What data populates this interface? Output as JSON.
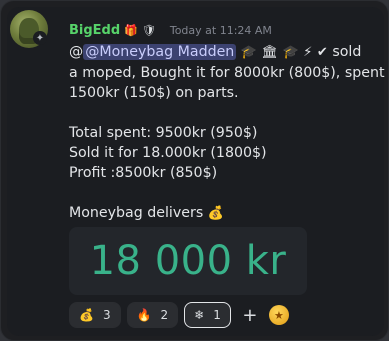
{
  "message": {
    "username": "BigEdd",
    "badge_icons": [
      "gift-icon",
      "shield-icon"
    ],
    "timestamp": "Today at 11:24 AM",
    "text_prefix": "@",
    "mention": "@Moneybag Madden",
    "lines_after_mention": " sold",
    "mention_icons": [
      "graduation-cap-icon",
      "bank-icon",
      "graduation-cap-icon",
      "lightning-icon",
      "verified-icon"
    ],
    "body_lines": [
      "a moped, Bought it for 8000kr (800$), spent",
      "1500kr (150$) on parts.",
      "",
      "Total spent: 9500kr (950$)",
      "Sold it for 18.000kr (1800$)",
      "Profit :8500kr (850$)",
      "",
      "Moneybag delivers"
    ],
    "delivers_icon": "money-bag-icon",
    "counter_value": "18 000 kr"
  },
  "reactions": [
    {
      "emoji": "💰",
      "icon": "money-bag-icon",
      "count": "3",
      "selected": false
    },
    {
      "emoji": "🔥",
      "icon": "fire-icon",
      "count": "2",
      "selected": false
    },
    {
      "emoji": "❄",
      "icon": "snowflake-icon",
      "count": "1",
      "selected": true
    }
  ],
  "add_reaction_label": "+",
  "colors": {
    "username": "#57d36a",
    "mention_bg": "#3c4270",
    "counter_text": "#39b28a"
  }
}
